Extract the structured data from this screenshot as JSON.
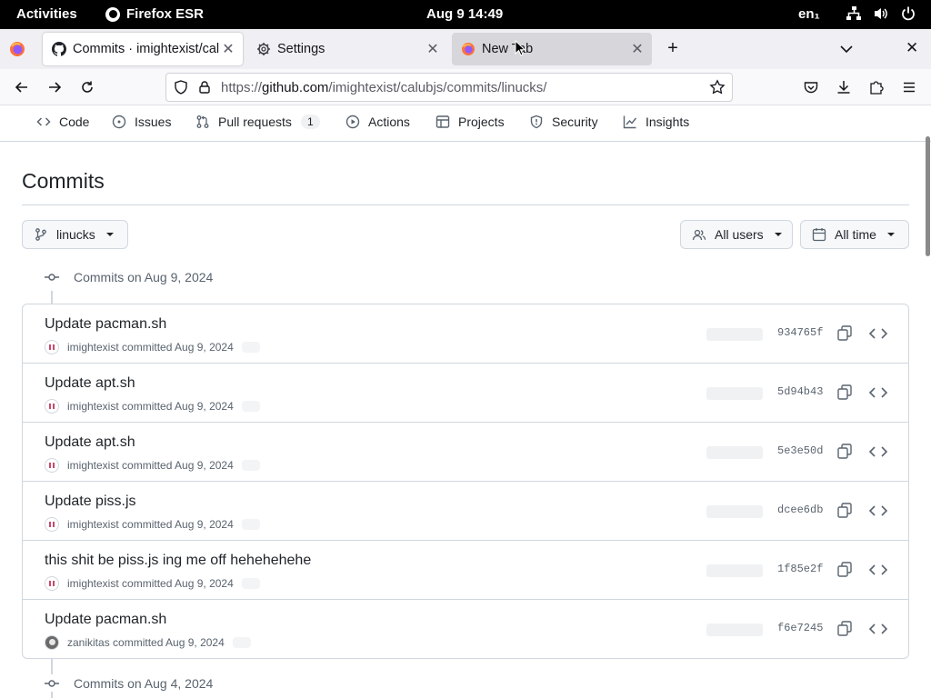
{
  "system_bar": {
    "activities": "Activities",
    "app_name": "Firefox ESR",
    "clock": "Aug 9  14:49",
    "language": "en₁"
  },
  "browser": {
    "tabs": [
      {
        "label": "Commits · imightexist/calubjs",
        "icon": "github-icon",
        "active": true
      },
      {
        "label": "Settings",
        "icon": "gear-icon",
        "active": false
      },
      {
        "label": "New Tab",
        "icon": "firefox-icon",
        "active": false
      }
    ],
    "url": {
      "scheme": "https://",
      "host": "github.com",
      "path": "/imightexist/calubjs/commits/linucks/"
    }
  },
  "repo_nav": {
    "items": [
      {
        "label": "Code",
        "icon": "code-icon"
      },
      {
        "label": "Issues",
        "icon": "issue-icon"
      },
      {
        "label": "Pull requests",
        "icon": "pull-request-icon",
        "count": "1"
      },
      {
        "label": "Actions",
        "icon": "play-icon"
      },
      {
        "label": "Projects",
        "icon": "table-icon"
      },
      {
        "label": "Security",
        "icon": "shield-icon"
      },
      {
        "label": "Insights",
        "icon": "graph-icon"
      }
    ]
  },
  "page": {
    "title": "Commits",
    "branch": "linucks",
    "user_filter": "All users",
    "time_filter": "All time"
  },
  "groups": [
    {
      "header": "Commits on Aug 9, 2024",
      "commits": [
        {
          "title": "Update pacman.sh",
          "author": "imightexist",
          "meta": "committed Aug 9, 2024",
          "sha": "934765f",
          "avatar": "identicon"
        },
        {
          "title": "Update apt.sh",
          "author": "imightexist",
          "meta": "committed Aug 9, 2024",
          "sha": "5d94b43",
          "avatar": "identicon"
        },
        {
          "title": "Update apt.sh",
          "author": "imightexist",
          "meta": "committed Aug 9, 2024",
          "sha": "5e3e50d",
          "avatar": "identicon"
        },
        {
          "title": "Update piss.js",
          "author": "imightexist",
          "meta": "committed Aug 9, 2024",
          "sha": "dcee6db",
          "avatar": "identicon"
        },
        {
          "title": "this shit be piss.js ing me off hehehehehe",
          "author": "imightexist",
          "meta": "committed Aug 9, 2024",
          "sha": "1f85e2f",
          "avatar": "identicon"
        },
        {
          "title": "Update pacman.sh",
          "author": "zanikitas",
          "meta": "committed Aug 9, 2024",
          "sha": "f6e7245",
          "avatar": "photo"
        }
      ]
    },
    {
      "header": "Commits on Aug 4, 2024",
      "commits": []
    }
  ]
}
